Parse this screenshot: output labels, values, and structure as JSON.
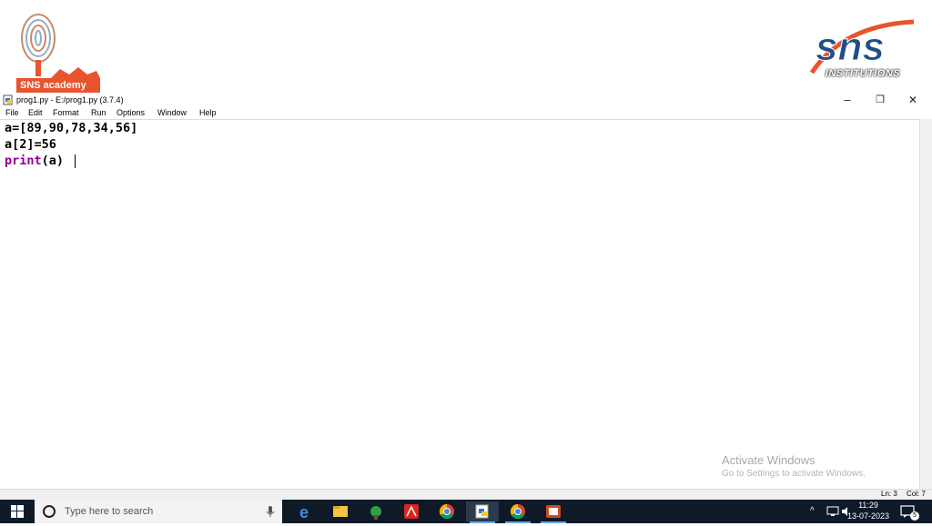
{
  "banner": {
    "left_logo_text": "SNS academy",
    "right_logo_text": "INSTITUTIONS",
    "right_logo_brand": "sns",
    "icons": {
      "left": "fingerprint-tree-icon",
      "right": "sns-logo-icon"
    },
    "colors": {
      "accent": "#e8542e",
      "brand_blue": "#1f4e8c"
    }
  },
  "window": {
    "title": "prog1.py - E:/prog1.py (3.7.4)",
    "minimize": "–",
    "restore": "❐",
    "close": "✕"
  },
  "menu": {
    "items": [
      "File",
      "Edit",
      "Format",
      "Run",
      "Options",
      "Window",
      "Help"
    ]
  },
  "editor": {
    "line1": "a=[89,90,78,34,56]",
    "line2": "a[2]=56",
    "line3_keyword": "print",
    "line3_rest": "(a)",
    "keyword_color": "#900090"
  },
  "watermark": {
    "line1": "Activate Windows",
    "line2": "Go to Settings to activate Windows."
  },
  "status": {
    "ln": "Ln: 3",
    "col": "Col: 7"
  },
  "taskbar": {
    "search_placeholder": "Type here to search",
    "time": "11:29",
    "date": "13-07-2023",
    "notification_count": "5",
    "apps": [
      "edge-icon",
      "file-explorer-icon",
      "game-icon",
      "acrobat-icon",
      "chrome-icon",
      "idle-icon",
      "chrome-icon",
      "powerpoint-icon"
    ]
  }
}
